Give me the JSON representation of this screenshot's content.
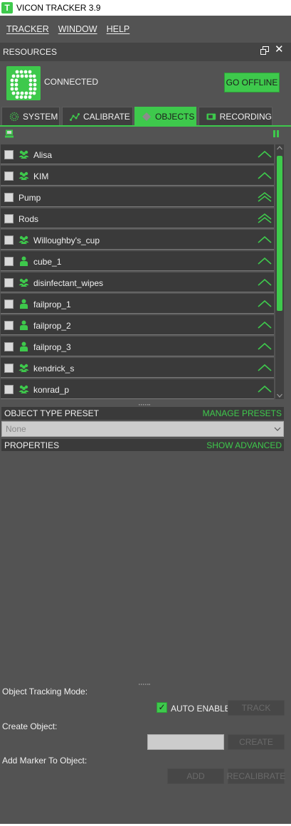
{
  "window": {
    "title": "VICON TRACKER 3.9",
    "icon": "app-logo-icon"
  },
  "menu": [
    "TRACKER",
    "WINDOW",
    "HELP"
  ],
  "resources": {
    "label": "RESOURCES",
    "status": "CONNECTED",
    "go_offline": "GO OFFLINE"
  },
  "tabs": [
    {
      "label": "SYSTEM",
      "icon": "system-icon",
      "active": false
    },
    {
      "label": "CALIBRATE",
      "icon": "calibrate-wand-icon",
      "active": false
    },
    {
      "label": "OBJECTS",
      "icon": "objects-diamond-icon",
      "active": true
    },
    {
      "label": "RECORDING",
      "icon": "camera-icon",
      "active": false
    }
  ],
  "objects": [
    {
      "name": "Alisa",
      "type": "group",
      "state": "single"
    },
    {
      "name": "KIM",
      "type": "group",
      "state": "single"
    },
    {
      "name": "Pump",
      "type": "none",
      "state": "double"
    },
    {
      "name": "Rods",
      "type": "none",
      "state": "double"
    },
    {
      "name": "Willoughby's_cup",
      "type": "group",
      "state": "single"
    },
    {
      "name": "cube_1",
      "type": "person",
      "state": "single"
    },
    {
      "name": "disinfectant_wipes",
      "type": "group",
      "state": "single"
    },
    {
      "name": "failprop_1",
      "type": "person",
      "state": "single"
    },
    {
      "name": "failprop_2",
      "type": "person",
      "state": "single"
    },
    {
      "name": "failprop_3",
      "type": "person",
      "state": "single"
    },
    {
      "name": "kendrick_s",
      "type": "group",
      "state": "single"
    },
    {
      "name": "konrad_p",
      "type": "group",
      "state": "single"
    }
  ],
  "preset": {
    "title": "OBJECT TYPE PRESET",
    "manage": "MANAGE PRESETS",
    "selected": "None"
  },
  "properties": {
    "title": "PROPERTIES",
    "show_advanced": "SHOW ADVANCED"
  },
  "controls": {
    "tracking_mode_label": "Object Tracking Mode:",
    "auto_enable": "AUTO ENABLE",
    "auto_enable_checked": true,
    "track": "TRACK",
    "create_object_label": "Create Object:",
    "create": "CREATE",
    "add_marker_label": "Add Marker To Object:",
    "add": "ADD",
    "recalibrate": "RECALIBRATE"
  },
  "colors": {
    "accent": "#3ec94c",
    "panel": "#535353",
    "row": "#3a3a3a"
  }
}
